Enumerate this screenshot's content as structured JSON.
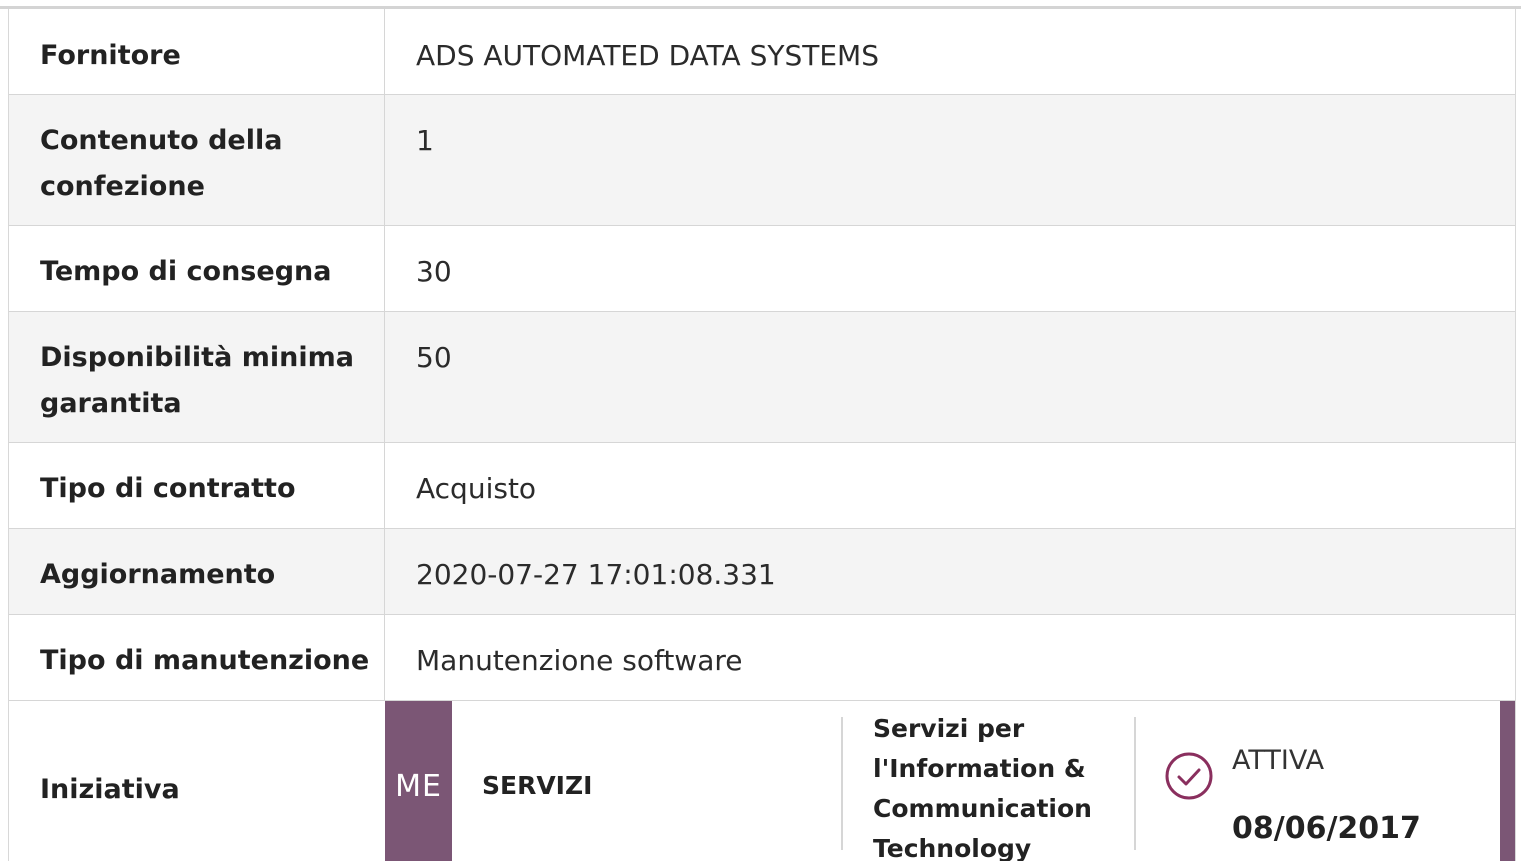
{
  "rows": [
    {
      "label": "Fornitore",
      "value": "ADS AUTOMATED DATA SYSTEMS"
    },
    {
      "label": "Contenuto della confezione",
      "value": "1"
    },
    {
      "label": "Tempo di consegna",
      "value": "30"
    },
    {
      "label": "Disponibilità minima garantita",
      "value": "50"
    },
    {
      "label": "Tipo di contratto",
      "value": "Acquisto"
    },
    {
      "label": "Aggiornamento",
      "value": "2020-07-27 17:01:08.331"
    },
    {
      "label": "Tipo di manutenzione",
      "value": "Manutenzione software"
    }
  ],
  "iniziativa": {
    "label": "Iniziativa",
    "badge": "ME",
    "type": "SERVIZI",
    "category": "Servizi per l'Information & Communication Technology",
    "status": "ATTIVA",
    "date": "08/06/2017",
    "colors": {
      "accent": "#7b5675"
    },
    "icon": "check-circle-icon"
  }
}
